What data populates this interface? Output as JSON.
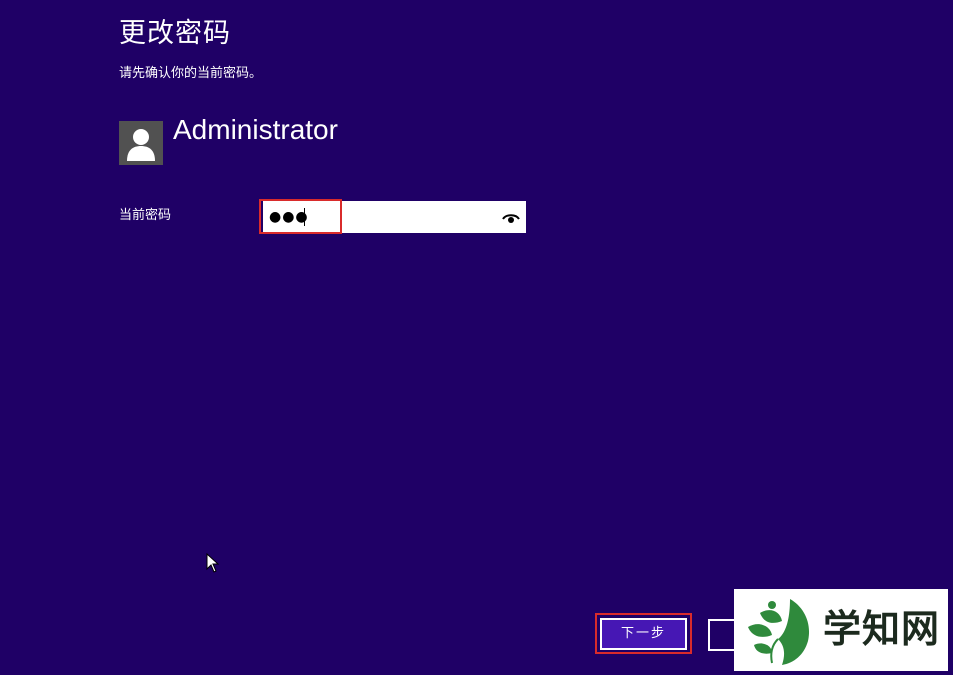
{
  "header": {
    "title": "更改密码",
    "subtitle": "请先确认你的当前密码。"
  },
  "user": {
    "name": "Administrator",
    "avatar_icon": "user-silhouette-icon"
  },
  "form": {
    "current_password_label": "当前密码",
    "current_password_value": "●●●",
    "reveal_icon": "eye-icon"
  },
  "actions": {
    "next_label": "下一步"
  },
  "watermark": {
    "text": "学知网",
    "logo_icon": "leaf-face-logo"
  },
  "colors": {
    "background": "#1f0066",
    "accent_button": "#4617b4",
    "highlight_border": "#d92b2b"
  }
}
